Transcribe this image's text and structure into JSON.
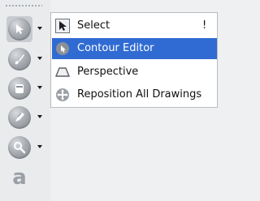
{
  "toolbar": {
    "tools": [
      {
        "icon": "select-arrow-icon",
        "has_menu": true,
        "active": true
      },
      {
        "icon": "brush-icon",
        "has_menu": true
      },
      {
        "icon": "paint-bucket-icon",
        "has_menu": true
      },
      {
        "icon": "pencil-brush-icon",
        "has_menu": true
      },
      {
        "icon": "zoom-icon",
        "has_menu": true
      },
      {
        "icon": "text-icon",
        "text": "a",
        "has_menu": false
      }
    ]
  },
  "menu": {
    "items": [
      {
        "label": "Select",
        "shortcut": "!",
        "icon": "select-icon",
        "highlighted": false
      },
      {
        "label": "Contour Editor",
        "shortcut": "",
        "icon": "contour-editor-icon",
        "highlighted": true
      },
      {
        "label": "Perspective",
        "shortcut": "",
        "icon": "perspective-icon",
        "highlighted": false
      },
      {
        "label": "Reposition All Drawings",
        "shortcut": "",
        "icon": "reposition-icon",
        "highlighted": false
      }
    ]
  },
  "colors": {
    "highlight": "#2f6bd2",
    "toolbar_bg": "#e9ebed"
  }
}
